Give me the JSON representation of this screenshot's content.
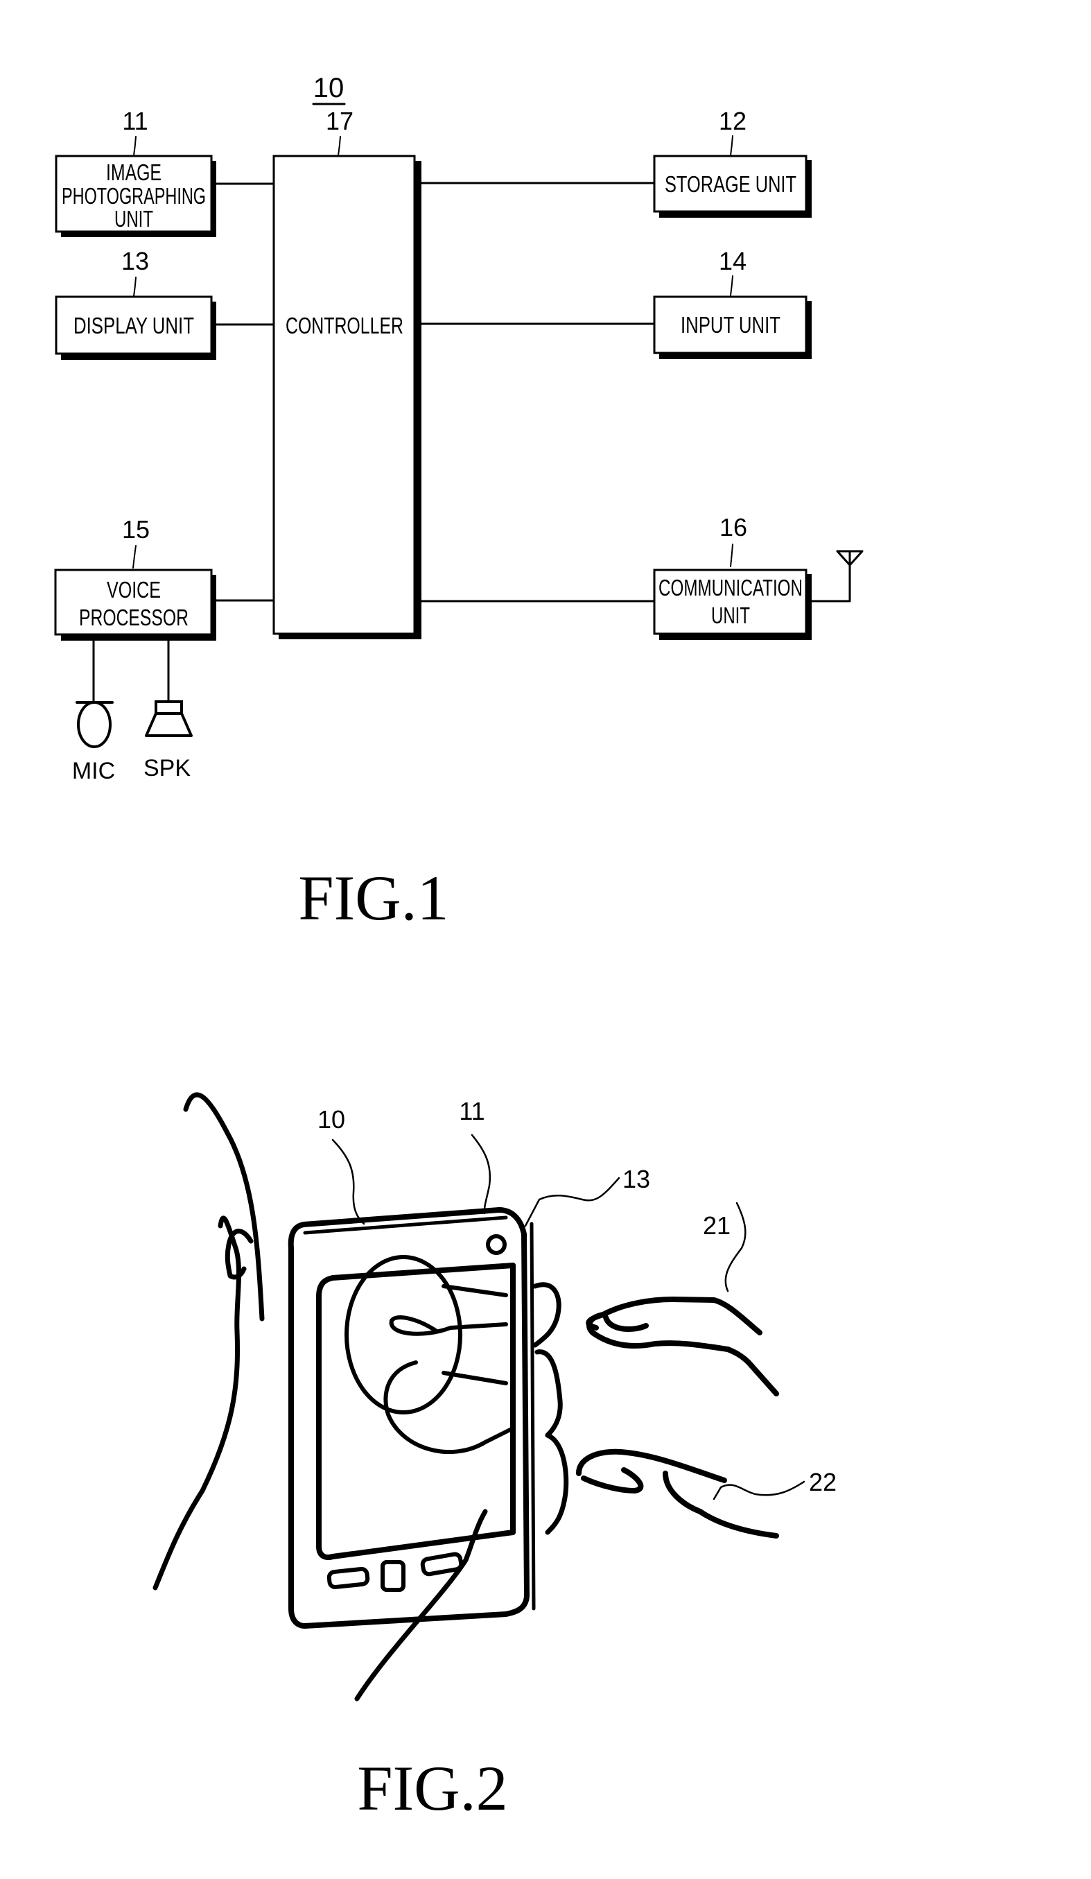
{
  "fig1": {
    "device_ref": "10",
    "caption": "FIG.1",
    "blocks": [
      {
        "id": "image-photographing-unit",
        "ref": "11",
        "lines": [
          "IMAGE",
          "PHOTOGRAPHING",
          "UNIT"
        ]
      },
      {
        "id": "storage-unit",
        "ref": "12",
        "lines": [
          "STORAGE UNIT"
        ]
      },
      {
        "id": "display-unit",
        "ref": "13",
        "lines": [
          "DISPLAY UNIT"
        ]
      },
      {
        "id": "input-unit",
        "ref": "14",
        "lines": [
          "INPUT UNIT"
        ]
      },
      {
        "id": "voice-processor",
        "ref": "15",
        "lines": [
          "VOICE",
          "PROCESSOR"
        ]
      },
      {
        "id": "communication-unit",
        "ref": "16",
        "lines": [
          "COMMUNICATION",
          "UNIT"
        ]
      },
      {
        "id": "controller",
        "ref": "17",
        "lines": [
          "CONTROLLER"
        ]
      }
    ],
    "connections": [
      [
        "image-photographing-unit",
        "controller"
      ],
      [
        "display-unit",
        "controller"
      ],
      [
        "voice-processor",
        "controller"
      ],
      [
        "controller",
        "storage-unit"
      ],
      [
        "controller",
        "input-unit"
      ],
      [
        "controller",
        "communication-unit"
      ],
      [
        "voice-processor",
        "mic"
      ],
      [
        "voice-processor",
        "spk"
      ],
      [
        "communication-unit",
        "antenna"
      ]
    ],
    "peripherals": {
      "mic": "MIC",
      "spk": "SPK"
    }
  },
  "fig2": {
    "caption": "FIG.2",
    "refs": {
      "device": "10",
      "camera": "11",
      "display": "13",
      "finger_1": "21",
      "finger_2": "22"
    }
  }
}
